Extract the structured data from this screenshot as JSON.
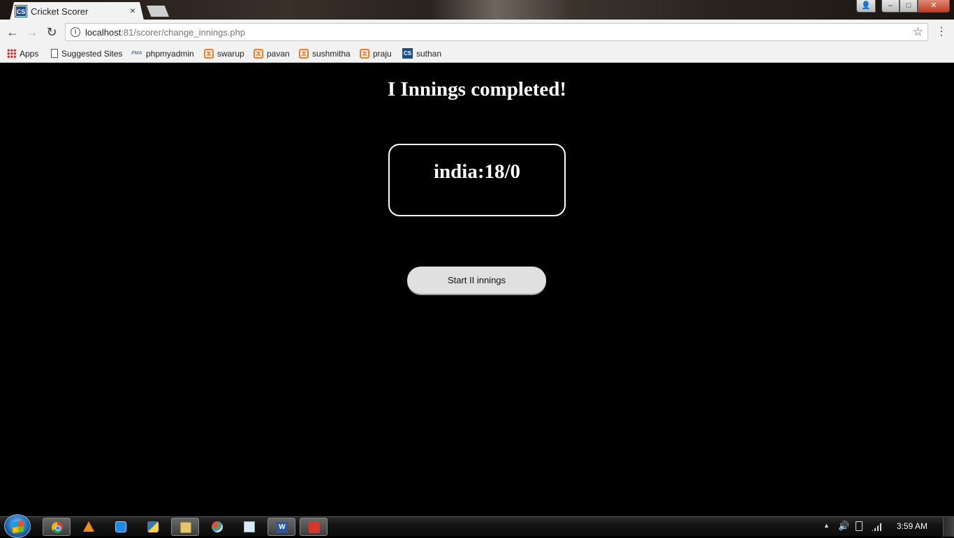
{
  "browser": {
    "tab_title": "Cricket Scorer",
    "tab_favicon_text": "CS",
    "tab_close": "×",
    "url_host": "localhost",
    "url_rest": ":81/scorer/change_innings.php"
  },
  "window_controls": {
    "minimize": "–",
    "maximize": "□",
    "close": "✕",
    "user": "👤"
  },
  "nav_icons": {
    "back": "←",
    "forward": "→",
    "reload": "↻",
    "star": "☆",
    "menu": "⋮"
  },
  "bookmarks": [
    {
      "label": "Apps",
      "icon": "apps-grid-icon"
    },
    {
      "label": "Suggested Sites",
      "icon": "page-icon"
    },
    {
      "label": "phpmyadmin",
      "icon": "phpmyadmin-icon",
      "icon_text": "PMA"
    },
    {
      "label": "swarup",
      "icon": "xampp-icon",
      "icon_text": "ⵣ"
    },
    {
      "label": "pavan",
      "icon": "xampp-icon",
      "icon_text": "ⵣ"
    },
    {
      "label": "sushmitha",
      "icon": "xampp-icon",
      "icon_text": "ⵣ"
    },
    {
      "label": "praju",
      "icon": "xampp-icon",
      "icon_text": "ⵣ"
    },
    {
      "label": "suthan",
      "icon": "cs-favicon-icon",
      "icon_text": "CS"
    }
  ],
  "page": {
    "heading": "I Innings completed!",
    "score": "india:18/0",
    "button_label": "Start II innings"
  },
  "taskbar": {
    "items": [
      "chrome-icon",
      "vlc-icon",
      "teamviewer-icon",
      "python-icon",
      "explorer-icon",
      "paint-icon",
      "notepad-icon",
      "word-icon",
      "app-icon"
    ],
    "word_icon_text": "W",
    "clock": "3:59 AM",
    "tray_chevron": "▲",
    "speaker": "🔊"
  },
  "colors": {
    "page_background": "#000000",
    "button_background": "#e0e0e0",
    "favicon_blue": "#1d4f86",
    "xampp_orange": "#f07c26"
  }
}
